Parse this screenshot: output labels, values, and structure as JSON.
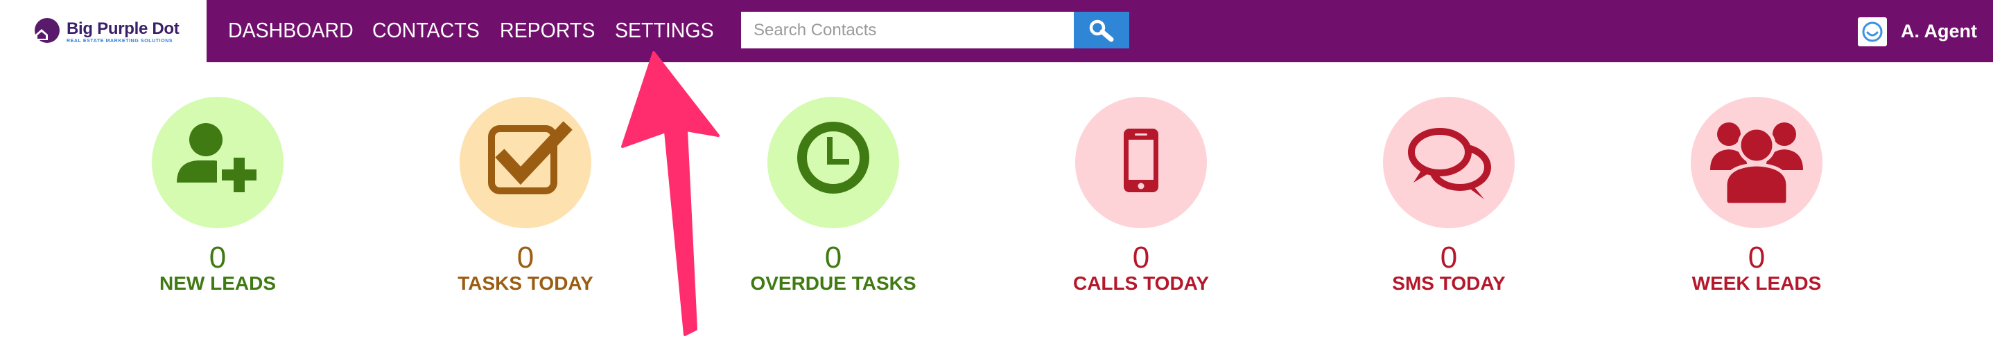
{
  "brand": {
    "name": "Big Purple Dot",
    "tagline": "REAL ESTATE MARKETING SOLUTIONS",
    "logo_icon": "purple-house-dot-icon"
  },
  "colors": {
    "nav_bg": "#710f6c",
    "search_button": "#2f86d6",
    "arrow": "#ff2d6e"
  },
  "nav": {
    "items": [
      {
        "label": "DASHBOARD"
      },
      {
        "label": "CONTACTS"
      },
      {
        "label": "REPORTS"
      },
      {
        "label": "SETTINGS"
      }
    ]
  },
  "search": {
    "placeholder": "Search Contacts",
    "value": "",
    "icon": "magnifier-icon"
  },
  "user": {
    "name": "A. Agent",
    "avatar_icon": "smiley-avatar-icon"
  },
  "stats": [
    {
      "label": "NEW LEADS",
      "count": "0",
      "icon": "user-plus-icon",
      "text_color": "#3f7a12",
      "bg_color": "#d4fbb0",
      "icon_color": "#3f7a12"
    },
    {
      "label": "TASKS TODAY",
      "count": "0",
      "icon": "checkbox-icon",
      "text_color": "#9b5d12",
      "bg_color": "#fde2b0",
      "icon_color": "#9b5d12"
    },
    {
      "label": "OVERDUE TASKS",
      "count": "0",
      "icon": "clock-icon",
      "text_color": "#3f7a12",
      "bg_color": "#d4fbb0",
      "icon_color": "#3f7a12"
    },
    {
      "label": "CALLS TODAY",
      "count": "0",
      "icon": "mobile-phone-icon",
      "text_color": "#b5172b",
      "bg_color": "#fdd3d8",
      "icon_color": "#b5172b"
    },
    {
      "label": "SMS TODAY",
      "count": "0",
      "icon": "chat-bubbles-icon",
      "text_color": "#b5172b",
      "bg_color": "#fdd3d8",
      "icon_color": "#b5172b"
    },
    {
      "label": "WEEK LEADS",
      "count": "0",
      "icon": "user-group-icon",
      "text_color": "#b5172b",
      "bg_color": "#fdd3d8",
      "icon_color": "#b5172b"
    }
  ]
}
